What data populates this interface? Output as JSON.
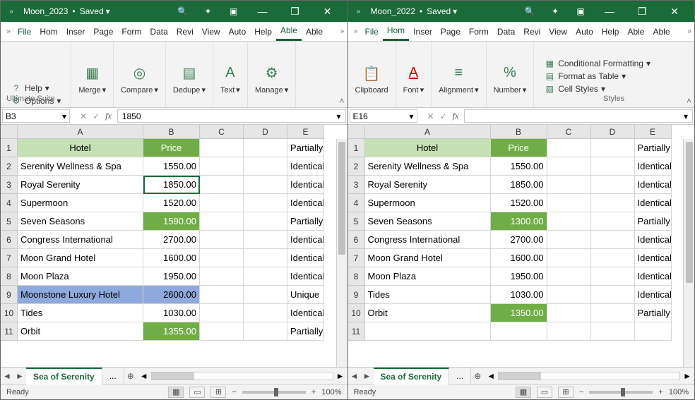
{
  "left": {
    "title": "Moon_2023",
    "saved": "Saved",
    "menu": {
      "file": "File",
      "tabs": [
        "Hom",
        "Inser",
        "Page",
        "Form",
        "Data",
        "Revi",
        "View",
        "Auto",
        "Help",
        "Able",
        "Able"
      ],
      "active_index": 9
    },
    "ribbon": {
      "help": "Help",
      "options": "Options",
      "merge": "Merge",
      "compare": "Compare",
      "dedupe": "Dedupe",
      "text": "Text",
      "manage": "Manage",
      "group_label": "Ultimate Suite"
    },
    "namebox": "B3",
    "formula": "1850",
    "columns": [
      "A",
      "B",
      "C",
      "D",
      "E"
    ],
    "header": {
      "a": "Hotel",
      "b": "Price"
    },
    "rows": [
      {
        "n": "1"
      },
      {
        "n": "2",
        "a": "Serenity Wellness & Spa",
        "b": "1550.00",
        "e": "Identical"
      },
      {
        "n": "3",
        "a": "Royal Serenity",
        "b": "1850.00",
        "e": "Identical",
        "sel": true
      },
      {
        "n": "4",
        "a": "Supermoon",
        "b": "1520.00",
        "e": "Identical"
      },
      {
        "n": "5",
        "a": "Seven Seasons",
        "b": "1590.00",
        "e": "Partially d",
        "b_hl": true
      },
      {
        "n": "6",
        "a": "Congress International",
        "b": "2700.00",
        "e": "Identical"
      },
      {
        "n": "7",
        "a": "Moon Grand Hotel",
        "b": "1600.00",
        "e": "Identical"
      },
      {
        "n": "8",
        "a": "Moon Plaza",
        "b": "1950.00",
        "e": "Identical"
      },
      {
        "n": "9",
        "a": "Moonstone Luxury Hotel",
        "b": "2600.00",
        "e": "Unique",
        "row_blue": true
      },
      {
        "n": "10",
        "a": "Tides",
        "b": "1030.00",
        "e": "Identical"
      },
      {
        "n": "11",
        "a": "Orbit",
        "b": "1355.00",
        "e": "Partially d",
        "b_hl": true
      }
    ],
    "e1": "Partially d",
    "sheet": "Sea of Serenity",
    "sheet_more": "...",
    "status": "Ready",
    "zoom": "100%"
  },
  "right": {
    "title": "Moon_2022",
    "saved": "Saved",
    "menu": {
      "file": "File",
      "tabs": [
        "Hom",
        "Inser",
        "Page",
        "Form",
        "Data",
        "Revi",
        "View",
        "Auto",
        "Help",
        "Able",
        "Able"
      ],
      "active_index": 0
    },
    "ribbon": {
      "clipboard": "Clipboard",
      "font": "Font",
      "alignment": "Alignment",
      "number": "Number",
      "cond_fmt": "Conditional Formatting",
      "fmt_table": "Format as Table",
      "cell_styles": "Cell Styles",
      "group_label": "Styles"
    },
    "namebox": "E16",
    "formula": "",
    "columns": [
      "A",
      "B",
      "C",
      "D",
      "E"
    ],
    "header": {
      "a": "Hotel",
      "b": "Price"
    },
    "rows": [
      {
        "n": "1"
      },
      {
        "n": "2",
        "a": "Serenity Wellness & Spa",
        "b": "1550.00",
        "e": "Identical"
      },
      {
        "n": "3",
        "a": "Royal Serenity",
        "b": "1850.00",
        "e": "Identical"
      },
      {
        "n": "4",
        "a": "Supermoon",
        "b": "1520.00",
        "e": "Identical"
      },
      {
        "n": "5",
        "a": "Seven Seasons",
        "b": "1300.00",
        "e": "Partially d",
        "b_hl": true
      },
      {
        "n": "6",
        "a": "Congress International",
        "b": "2700.00",
        "e": "Identical"
      },
      {
        "n": "7",
        "a": "Moon Grand Hotel",
        "b": "1600.00",
        "e": "Identical"
      },
      {
        "n": "8",
        "a": "Moon Plaza",
        "b": "1950.00",
        "e": "Identical"
      },
      {
        "n": "9",
        "a": "Tides",
        "b": "1030.00",
        "e": "Identical"
      },
      {
        "n": "10",
        "a": "Orbit",
        "b": "1350.00",
        "e": "Partially d",
        "b_hl": true
      },
      {
        "n": "11",
        "a": "",
        "b": "",
        "e": ""
      }
    ],
    "e1": "Partially",
    "sheet": "Sea of Serenity",
    "sheet_more": "...",
    "status": "Ready",
    "zoom": "100%"
  },
  "glyph": {
    "chev_right": "»",
    "chev_down": "▾",
    "search": "🔍",
    "wand": "✦",
    "maximize": "▣",
    "minimize": "—",
    "restore": "❐",
    "close": "✕",
    "merge": "▦",
    "compare": "◎",
    "dedupe": "▤",
    "text": "A",
    "manage": "⚙",
    "question": "?",
    "gear": "⚙",
    "fx": "fx",
    "cancel": "✕",
    "enter": "✓",
    "collapse": "˄",
    "plus": "⊕",
    "left": "◄",
    "right_tri": "►",
    "minus": "−",
    "plus_s": "+",
    "paste": "📋",
    "percent": "%",
    "align": "≡",
    "fontA": "A"
  }
}
